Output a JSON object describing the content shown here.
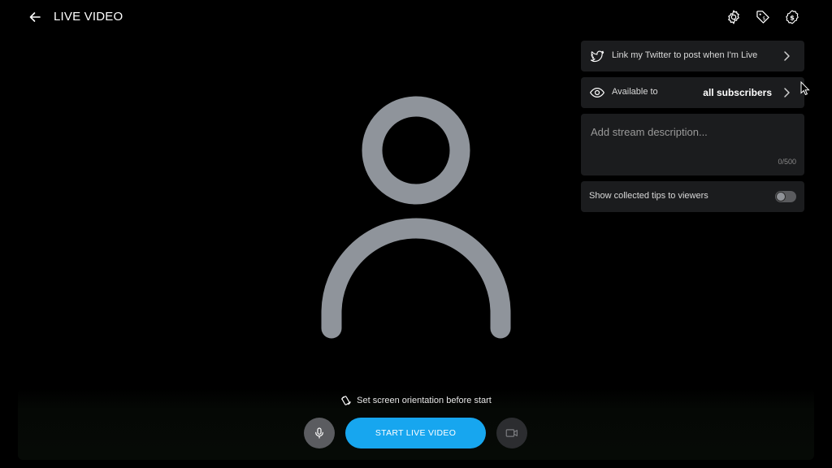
{
  "header": {
    "title": "LIVE VIDEO",
    "back_icon": "arrow-left-icon",
    "icons": [
      "settings-gear-icon",
      "price-tag-icon",
      "dollar-coin-icon"
    ]
  },
  "panel": {
    "twitter": {
      "label": "Link my Twitter to post when I'm Live",
      "icon": "twitter-bird-icon"
    },
    "availability": {
      "label": "Available to",
      "value": "all subscribers",
      "icon": "eye-icon"
    },
    "description": {
      "placeholder": "Add stream description...",
      "value": "",
      "counter": "0/500"
    },
    "tips": {
      "label": "Show collected tips to viewers",
      "enabled": false
    }
  },
  "bottom": {
    "orientation_hint": "Set screen orientation before start",
    "start_label": "START LIVE VIDEO",
    "mic_icon": "microphone-icon",
    "camera_icon": "video-camera-icon"
  },
  "colors": {
    "background": "#000000",
    "card": "#1b1c1e",
    "accent": "#17a6ef",
    "avatar": "#8f949b"
  }
}
